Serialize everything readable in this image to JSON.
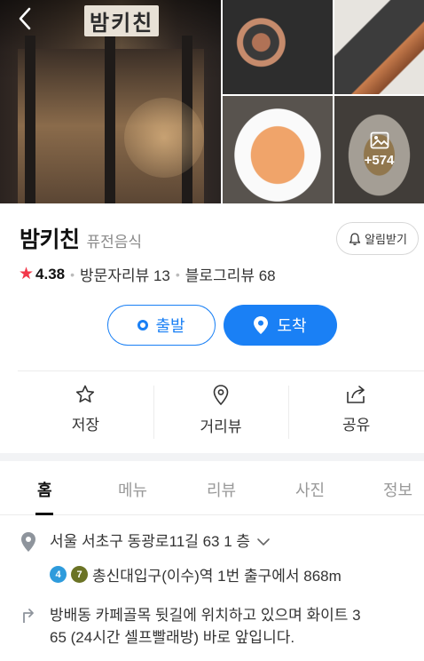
{
  "gallery": {
    "sign_text": "밤키친",
    "more_photos": "+574"
  },
  "place": {
    "name": "밤키친",
    "category": "퓨전음식",
    "alert_label": "알림받기"
  },
  "rating": {
    "score": "4.38",
    "visitor_reviews": "방문자리뷰 13",
    "blog_reviews": "블로그리뷰 68",
    "star_color": "#f2384a"
  },
  "route": {
    "depart_label": "출발",
    "arrive_label": "도착",
    "accent": "#1a80f5"
  },
  "actions": [
    {
      "label": "저장",
      "icon": "star-outline-icon"
    },
    {
      "label": "거리뷰",
      "icon": "location-pin-icon"
    },
    {
      "label": "공유",
      "icon": "share-icon"
    }
  ],
  "tabs": [
    {
      "label": "홈",
      "active": true
    },
    {
      "label": "메뉴",
      "active": false
    },
    {
      "label": "리뷰",
      "active": false
    },
    {
      "label": "사진",
      "active": false
    },
    {
      "label": "정보",
      "active": false
    }
  ],
  "info": {
    "address": "서울 서초구 동광로11길 63 1 층",
    "subway_lines": [
      {
        "number": "4",
        "color": "#2e9bdc"
      },
      {
        "number": "7",
        "color": "#6b7325"
      }
    ],
    "subway_text": "총신대입구(이수)역 1번 출구에서 868m",
    "directions_line1": "방배동 카페골목 뒷길에 위치하고 있으며 화이트 3",
    "directions_line2": "65 (24시간 셀프빨래방) 바로 앞입니다."
  }
}
